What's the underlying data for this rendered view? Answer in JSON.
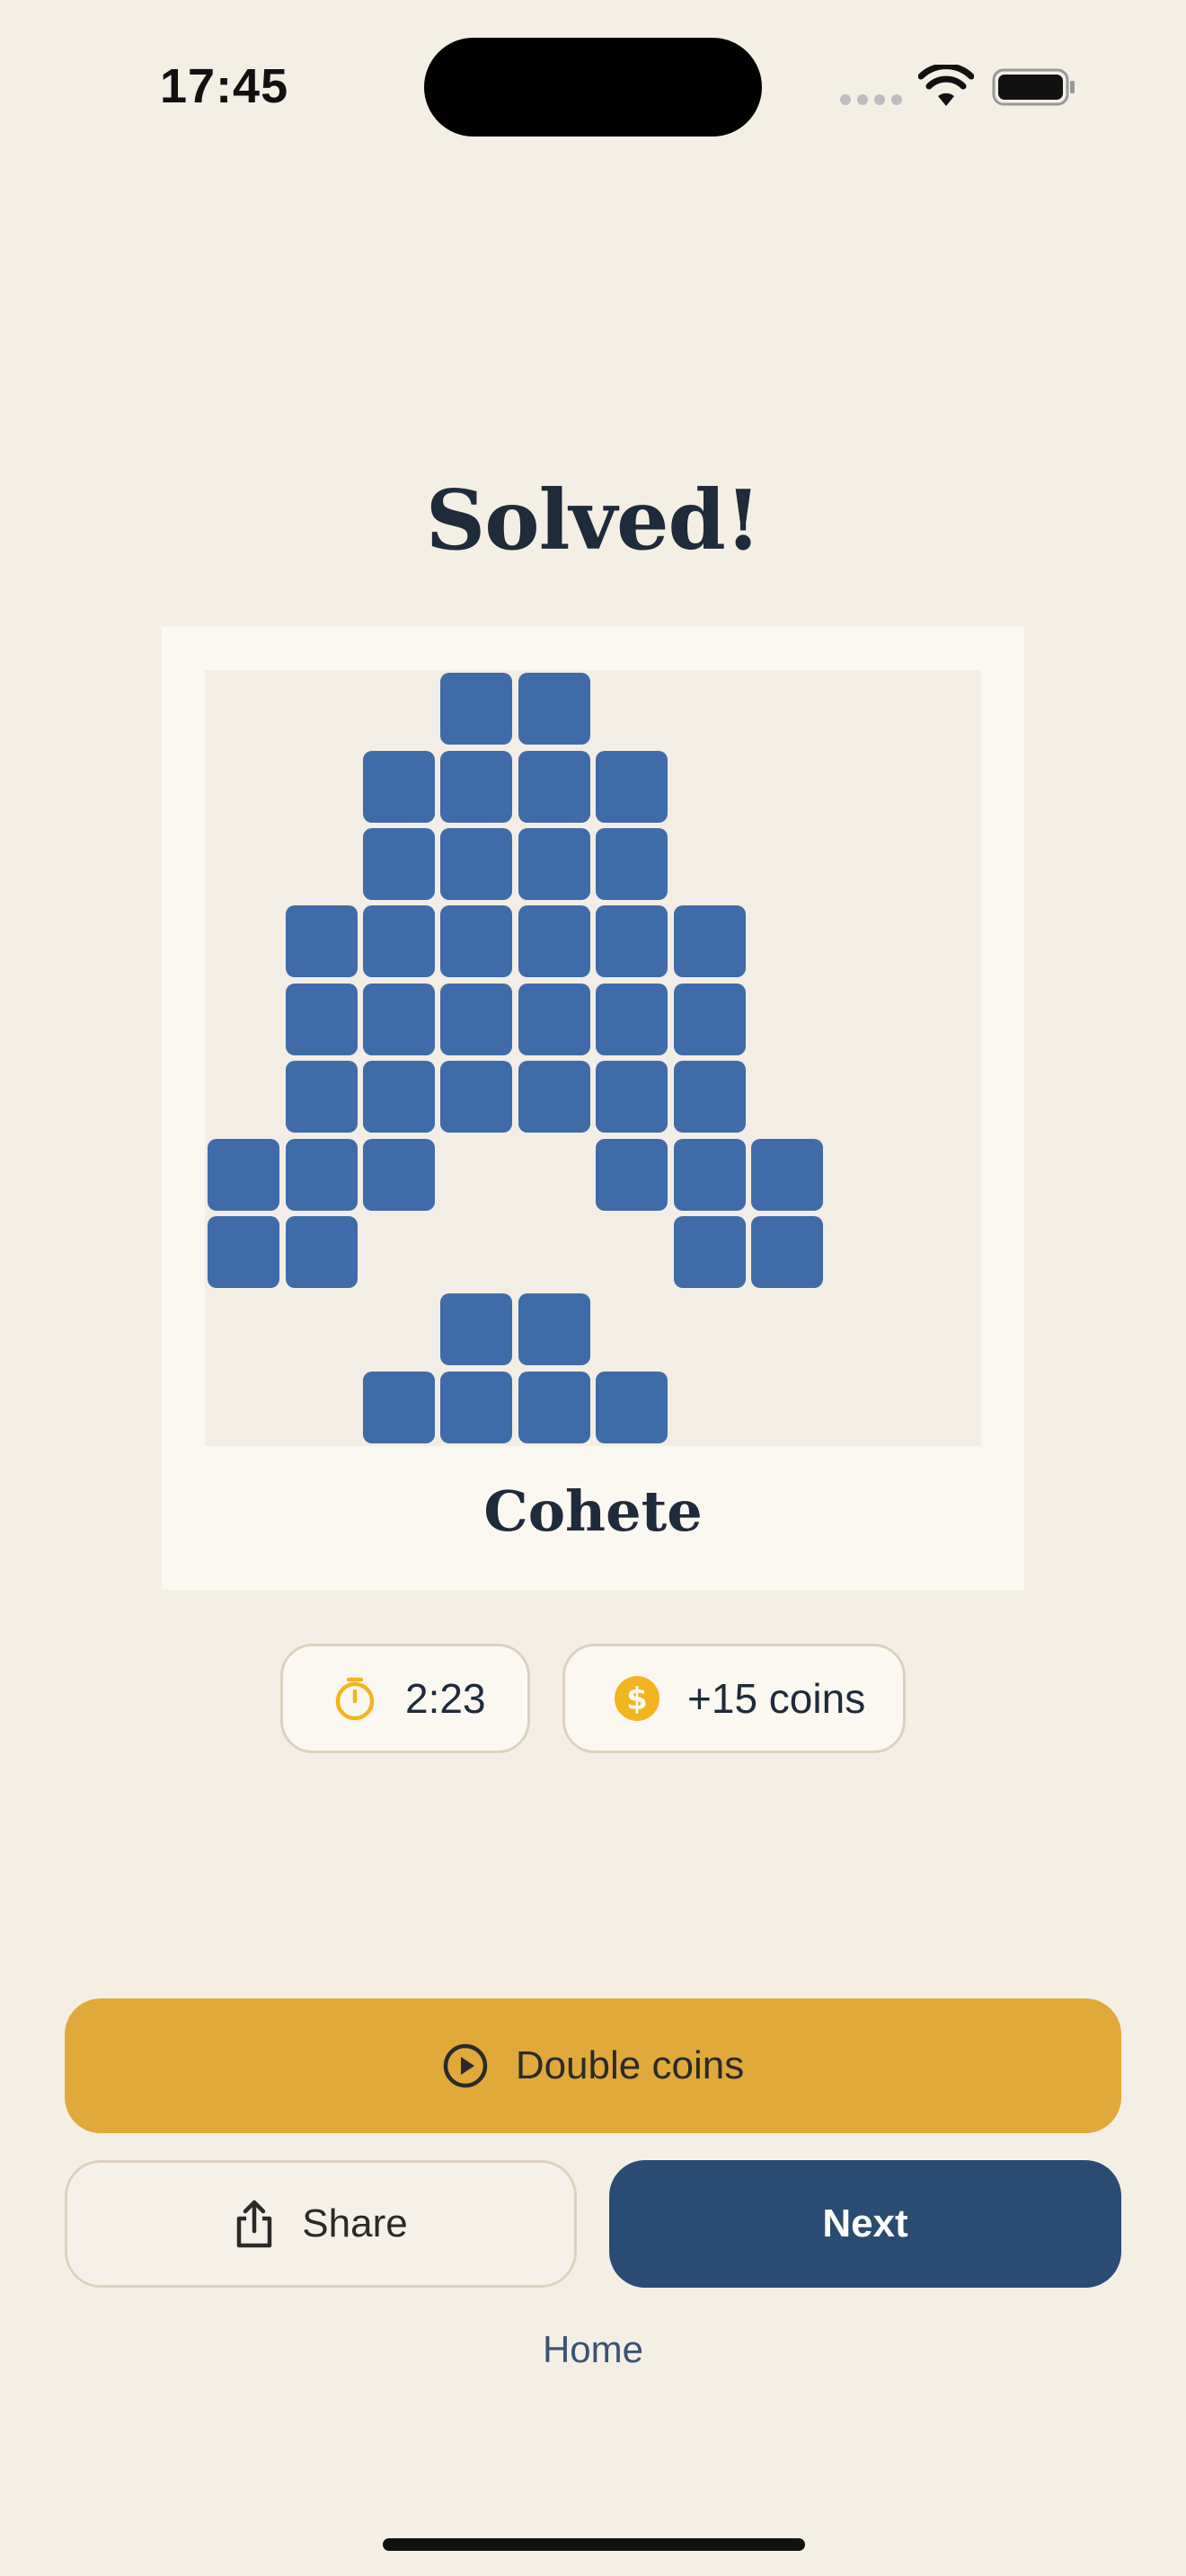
{
  "status_bar": {
    "time": "17:45"
  },
  "title": "Solved!",
  "puzzle": {
    "name": "Cohete",
    "grid_size": 10,
    "filled_color": "#3f6ca9",
    "rows": [
      "...XX.....",
      "..XXXX....",
      "..XXXX....",
      ".XXXXXX...",
      ".XXXXXX...",
      ".XXXXXX...",
      "XXX..XXX..",
      "XX....XX..",
      "...XX.....",
      "..XXXX...."
    ]
  },
  "stats": {
    "time_icon": "stopwatch-icon",
    "time": "2:23",
    "coins_icon": "coin-icon",
    "coins": "+15 coins"
  },
  "actions": {
    "double_coins_icon": "play-circle-icon",
    "double_coins": "Double coins",
    "share_icon": "share-icon",
    "share": "Share",
    "next": "Next",
    "home": "Home"
  },
  "colors": {
    "background": "#f4efe5",
    "accent_gold": "#e0a93a",
    "primary_navy": "#2a4c72",
    "icon_yellow": "#f2b520"
  }
}
